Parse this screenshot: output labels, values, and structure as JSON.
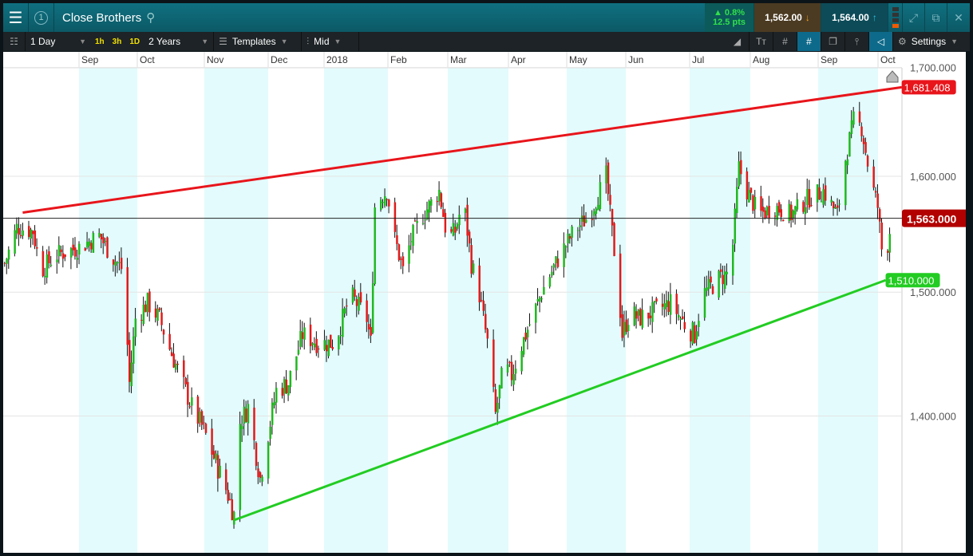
{
  "header": {
    "title": "Close Brothers",
    "badge": "1",
    "change_pct": "▲ 0.8%",
    "change_pts": "12.5 pts",
    "sell": "1,562.00",
    "buy": "1,564.00"
  },
  "toolbar": {
    "interval": "1 Day",
    "quick": [
      "1h",
      "3h",
      "1D"
    ],
    "range": "2 Years",
    "templates": "Templates",
    "price_type": "Mid",
    "settings": "Settings"
  },
  "colors": {
    "up": "#1fb81f",
    "down": "#e01b1b",
    "resistance": "#e8151b",
    "support": "#22cc22",
    "band": "#e3fbfd"
  },
  "chart_data": {
    "type": "candlestick",
    "x_unit": "days since 2017-09-01",
    "month_labels": [
      "Sep",
      "Oct",
      "Nov",
      "Dec",
      "2018",
      "Feb",
      "Mar",
      "Apr",
      "May",
      "Jun",
      "Jul",
      "Aug",
      "Sep",
      "Oct"
    ],
    "y_ticks": [
      "1,700.000",
      "1,600.000",
      "1,500.000",
      "1,400.000"
    ],
    "y_tick_values": [
      1700,
      1600,
      1500,
      1400
    ],
    "yscale": "log",
    "current_price": 1563,
    "current_label": "1,563.000",
    "trendlines": [
      {
        "name": "resistance",
        "from": [
          -28,
          1568
        ],
        "to": [
          409,
          1681.408
        ],
        "label": "1,681.408"
      },
      {
        "name": "support",
        "from": [
          77,
          1321
        ],
        "to": [
          401,
          1510
        ],
        "label": "1,510.000"
      }
    ],
    "waypoints": [
      [
        -37,
        1524
      ],
      [
        -31,
        1555
      ],
      [
        -23,
        1552
      ],
      [
        -19,
        1518
      ],
      [
        -12,
        1531
      ],
      [
        0,
        1538
      ],
      [
        10,
        1548
      ],
      [
        16,
        1531
      ],
      [
        22,
        1518
      ],
      [
        25,
        1426
      ],
      [
        28,
        1478
      ],
      [
        34,
        1491
      ],
      [
        40,
        1478
      ],
      [
        44,
        1458
      ],
      [
        50,
        1432
      ],
      [
        56,
        1407
      ],
      [
        62,
        1389
      ],
      [
        68,
        1364
      ],
      [
        74,
        1340
      ],
      [
        77,
        1325
      ],
      [
        80,
        1395
      ],
      [
        84,
        1407
      ],
      [
        90,
        1352
      ],
      [
        92,
        1370
      ],
      [
        98,
        1420
      ],
      [
        104,
        1426
      ],
      [
        111,
        1465
      ],
      [
        119,
        1458
      ],
      [
        127,
        1458
      ],
      [
        135,
        1498
      ],
      [
        143,
        1478
      ],
      [
        145,
        1458
      ],
      [
        147,
        1573
      ],
      [
        149,
        1580
      ],
      [
        153,
        1587
      ],
      [
        157,
        1545
      ],
      [
        161,
        1518
      ],
      [
        165,
        1545
      ],
      [
        171,
        1566
      ],
      [
        179,
        1587
      ],
      [
        183,
        1545
      ],
      [
        187,
        1552
      ],
      [
        191,
        1580
      ],
      [
        195,
        1524
      ],
      [
        199,
        1498
      ],
      [
        203,
        1458
      ],
      [
        207,
        1401
      ],
      [
        211,
        1439
      ],
      [
        215,
        1432
      ],
      [
        219,
        1452
      ],
      [
        225,
        1478
      ],
      [
        231,
        1504
      ],
      [
        239,
        1531
      ],
      [
        246,
        1552
      ],
      [
        254,
        1566
      ],
      [
        262,
        1601
      ],
      [
        264,
        1566
      ],
      [
        268,
        1504
      ],
      [
        270,
        1465
      ],
      [
        274,
        1484
      ],
      [
        278,
        1478
      ],
      [
        286,
        1484
      ],
      [
        294,
        1491
      ],
      [
        302,
        1471
      ],
      [
        306,
        1465
      ],
      [
        310,
        1498
      ],
      [
        318,
        1511
      ],
      [
        324,
        1518
      ],
      [
        328,
        1608
      ],
      [
        332,
        1587
      ],
      [
        338,
        1566
      ],
      [
        346,
        1573
      ],
      [
        354,
        1566
      ],
      [
        362,
        1580
      ],
      [
        370,
        1587
      ],
      [
        377,
        1566
      ],
      [
        381,
        1615
      ],
      [
        385,
        1651
      ],
      [
        389,
        1644
      ],
      [
        393,
        1601
      ],
      [
        397,
        1573
      ],
      [
        400,
        1518
      ],
      [
        403,
        1552
      ]
    ]
  }
}
